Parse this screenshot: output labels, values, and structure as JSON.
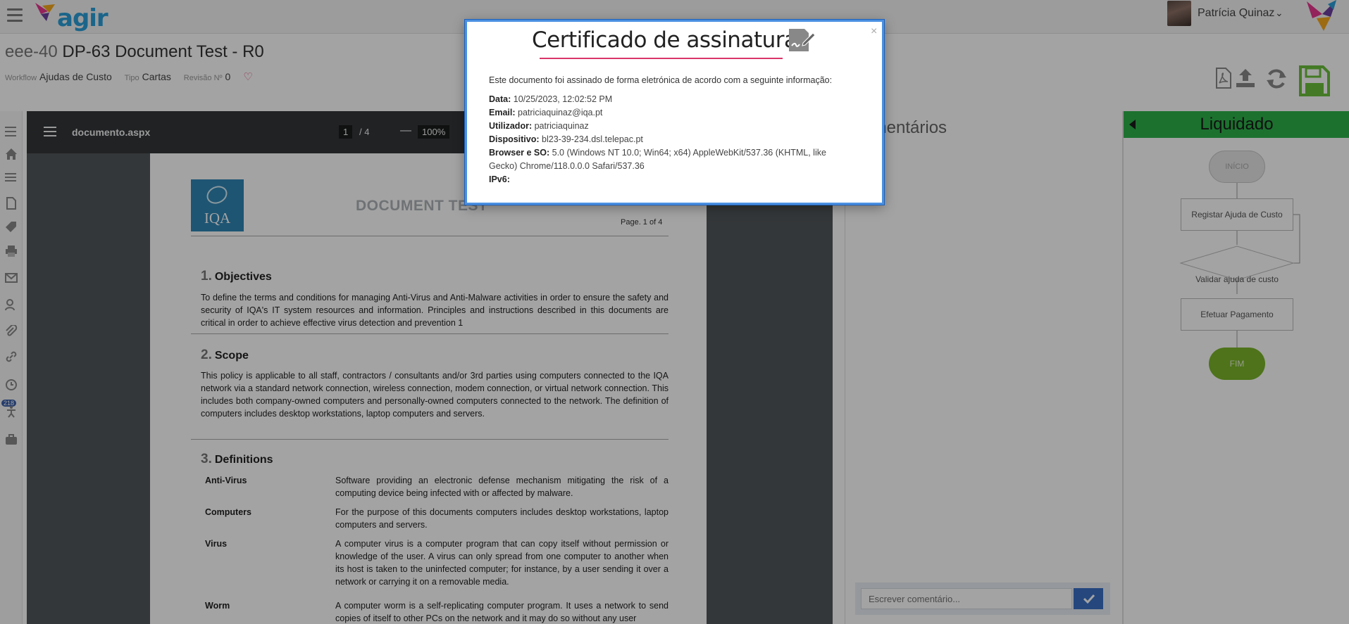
{
  "app": {
    "logo_text": "agir",
    "user_name": "Patrícia Quinaz"
  },
  "header": {
    "code": "eee-40",
    "title": "DP-63 Document Test - R0",
    "workflow_label": "Workflow",
    "workflow_value": "Ajudas de Custo",
    "type_label": "Tipo",
    "type_value": "Cartas",
    "revision_label": "Revisão Nº",
    "revision_value": "0"
  },
  "rail": {
    "badge": "218"
  },
  "viewer": {
    "file_name": "documento.aspx",
    "current_page": "1",
    "total_pages": "/ 4",
    "zoom": "100%"
  },
  "document": {
    "logo_text": "IQA",
    "heading": "DOCUMENT TEST",
    "page_label": "Page. 1 of 4",
    "sections": [
      {
        "num": "1.",
        "title": "Objectives",
        "text": "To define the terms and conditions for managing Anti-Virus and Anti-Malware activities in order to ensure the safety and security of IQA's IT system resources and information. Principles and instructions described in this documents are critical in order to achieve effective virus detection and prevention 1"
      },
      {
        "num": "2.",
        "title": "Scope",
        "text": "This policy is applicable to all staff, contractors / consultants and/or 3rd parties using computers connected to the IQA network via a standard network connection, wireless connection, modem connection, or virtual network connection. This includes both company-owned computers and personally-owned computers connected to the network. The definition of computers includes desktop workstations, laptop computers and servers."
      },
      {
        "num": "3.",
        "title": "Definitions",
        "text": ""
      }
    ],
    "definitions": [
      {
        "term": "Anti-Virus",
        "def": "Software providing an electronic defense mechanism mitigating the risk of a computing device being infected with or affected by malware."
      },
      {
        "term": "Computers",
        "def": "For the purpose of this documents computers includes desktop workstations, laptop computers and servers."
      },
      {
        "term": "Virus",
        "def": "A computer virus is a computer program that can copy itself without permission or knowledge of the user. A virus can only spread from one computer to another when its host is taken to the uninfected computer; for instance, by a user sending it over a network or carrying it on a removable media."
      },
      {
        "term": "Worm",
        "def": "A computer worm is a self-replicating computer program. It uses a network to send copies of itself to other PCs on the network and it may do so without any user"
      }
    ]
  },
  "comments": {
    "title": "Comentários",
    "placeholder": "Escrever comentário..."
  },
  "workflow": {
    "status": "Liquidado",
    "start": "INÍCIO",
    "step1": "Registar Ajuda de Custo",
    "decision": "Validar ajuda de custo",
    "step2": "Efetuar Pagamento",
    "end": "FIM",
    "header_color": "#2db14a",
    "end_color": "#7ab52a"
  },
  "modal": {
    "title": "Certificado de assinatura",
    "close": "×",
    "intro": "Este documento foi assinado de forma eletrónica de acordo com a seguinte informação:",
    "fields": [
      {
        "label": "Data:",
        "value": "10/25/2023, 12:02:52 PM"
      },
      {
        "label": "Email:",
        "value": "patriciaquinaz@iqa.pt"
      },
      {
        "label": "Utilizador:",
        "value": "patriciaquinaz"
      },
      {
        "label": "Dispositivo:",
        "value": "bl23-39-234.dsl.telepac.pt"
      },
      {
        "label": "Browser e SO:",
        "value": "5.0 (Windows NT 10.0; Win64; x64) AppleWebKit/537.36 (KHTML, like Gecko) Chrome/118.0.0.0 Safari/537.36"
      },
      {
        "label": "IPv6:",
        "value": ""
      }
    ],
    "accent_color": "#d9356a"
  }
}
